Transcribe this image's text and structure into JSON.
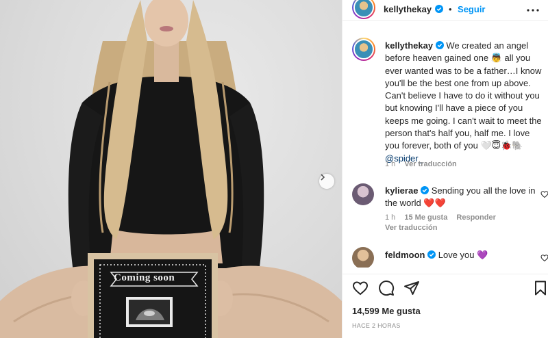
{
  "post": {
    "username": "kellythekay",
    "follow_label": "Seguir",
    "dot": "•",
    "caption": {
      "part1": "We created an angel before heaven gained one ",
      "angel_emoji": "👼",
      "part2": " all you ever wanted was to be a father…I know you'll be the best one from up above. Can't believe I have to do it without you but knowing I'll have a piece of you keeps me going. I can't wait to meet the person that's half you, half me. I love you forever, both of you ",
      "emojis_end": "🤍😇🐞🐘",
      "mention": "@spider_",
      "time": "1 h",
      "translate_label": "Ver traducción"
    },
    "likes_label": "14,599 Me gusta",
    "posted_time": "HACE 2 HORAS"
  },
  "photo": {
    "sign_text": "Coming soon"
  },
  "comments": [
    {
      "username": "kylierae",
      "text": "Sending you all the love in the world ",
      "emoji": "❤️❤️",
      "time": "1 h",
      "likes": "15 Me gusta",
      "reply_label": "Responder",
      "translate_label": "Ver traducción"
    },
    {
      "username": "feldmoon",
      "text": "Love you ",
      "emoji": "💜"
    }
  ],
  "icons": [
    "verified-badge-icon",
    "more-options-icon",
    "heart-icon",
    "comment-icon",
    "share-icon",
    "bookmark-icon",
    "chevron-right-icon"
  ],
  "colors": {
    "accent": "#0095f6",
    "text": "#262626",
    "muted": "#8e8e8e",
    "border": "#efefef"
  }
}
